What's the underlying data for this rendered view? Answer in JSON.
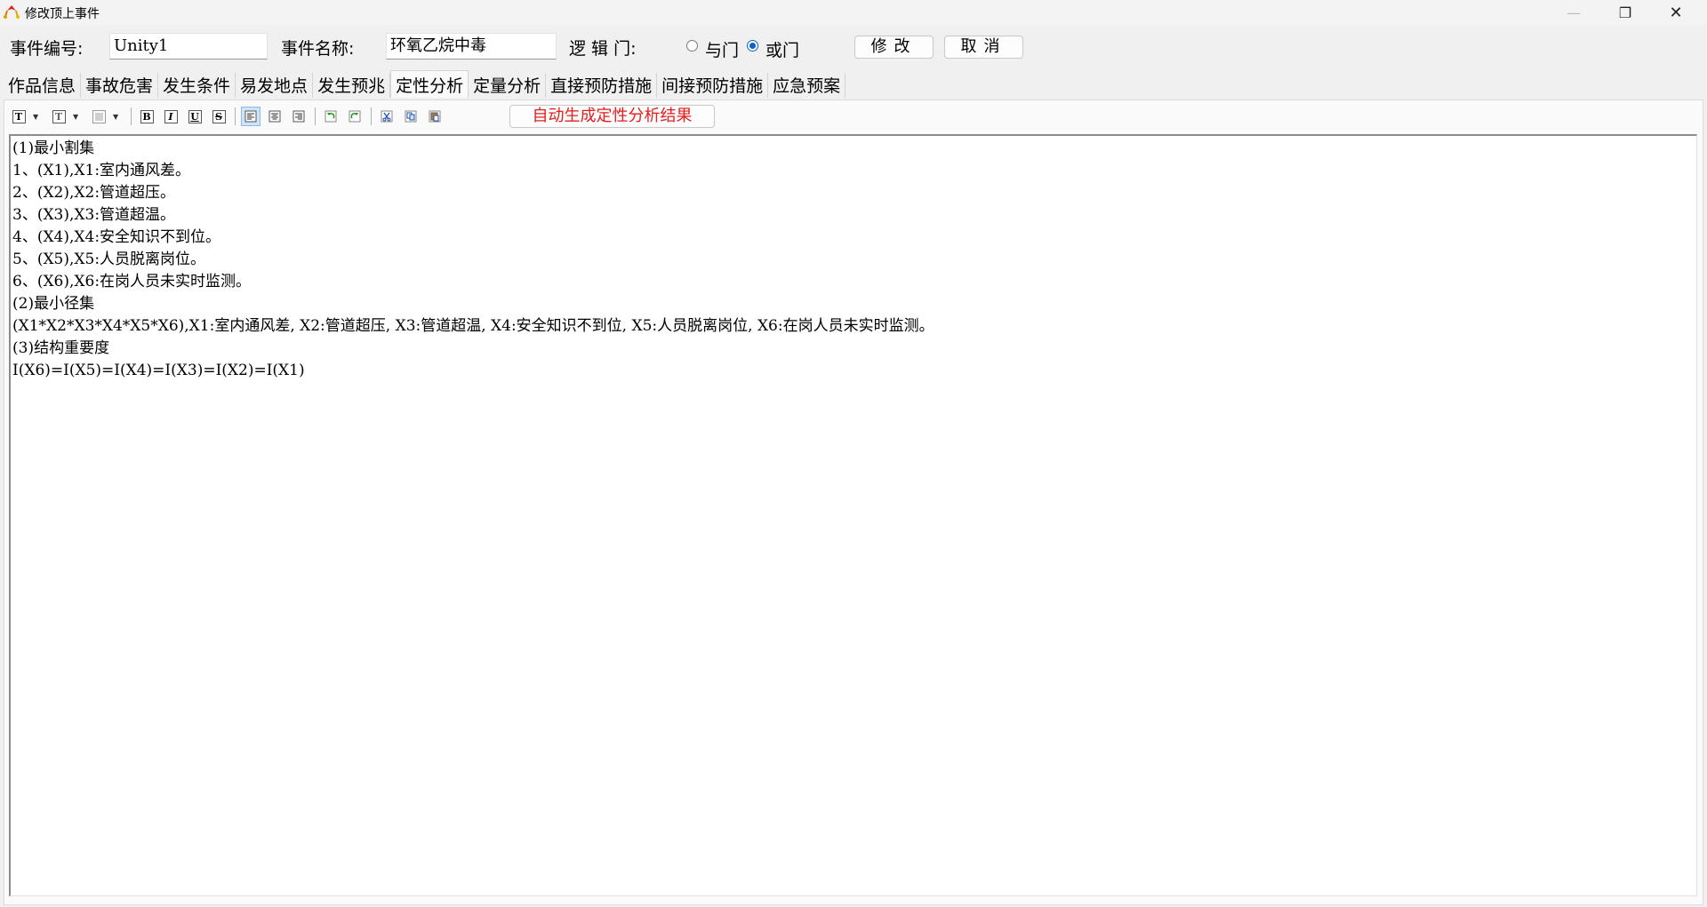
{
  "window": {
    "title": "修改顶上事件",
    "minimize": "—",
    "maximize": "❐",
    "close": "✕"
  },
  "form": {
    "event_id_label": "事件编号:",
    "event_id_value": "Unity1",
    "event_name_label": "事件名称:",
    "event_name_value": "环氧乙烷中毒",
    "logic_gate_label": "逻 辑 门:",
    "and_gate_label": "与门",
    "or_gate_label": "或门",
    "selected_gate": "或门",
    "modify_button": "修改",
    "cancel_button": "取消"
  },
  "tabs": [
    {
      "label": "作品信息",
      "active": false
    },
    {
      "label": "事故危害",
      "active": false
    },
    {
      "label": "发生条件",
      "active": false
    },
    {
      "label": "易发地点",
      "active": false
    },
    {
      "label": "发生预兆",
      "active": false
    },
    {
      "label": "定性分析",
      "active": true
    },
    {
      "label": "定量分析",
      "active": false
    },
    {
      "label": "直接预防措施",
      "active": false
    },
    {
      "label": "间接预防措施",
      "active": false
    },
    {
      "label": "应急预案",
      "active": false
    }
  ],
  "toolbar": {
    "font_icon": "T",
    "font_size_icon": "T",
    "bold_icon": "B",
    "italic_icon": "I",
    "underline_icon": "U",
    "strike_icon": "S",
    "generate_button": "自动生成定性分析结果"
  },
  "editor": {
    "lines": [
      "(1)最小割集",
      "1、(X1),X1:室内通风差。",
      "2、(X2),X2:管道超压。",
      "3、(X3),X3:管道超温。",
      "4、(X4),X4:安全知识不到位。",
      "5、(X5),X5:人员脱离岗位。",
      "6、(X6),X6:在岗人员未实时监测。",
      "(2)最小径集",
      "(X1*X2*X3*X4*X5*X6),X1:室内通风差, X2:管道超压, X3:管道超温, X4:安全知识不到位, X5:人员脱离岗位, X6:在岗人员未实时监测。",
      "(3)结构重要度",
      "I(X6)=I(X5)=I(X4)=I(X3)=I(X2)=I(X1)"
    ]
  }
}
